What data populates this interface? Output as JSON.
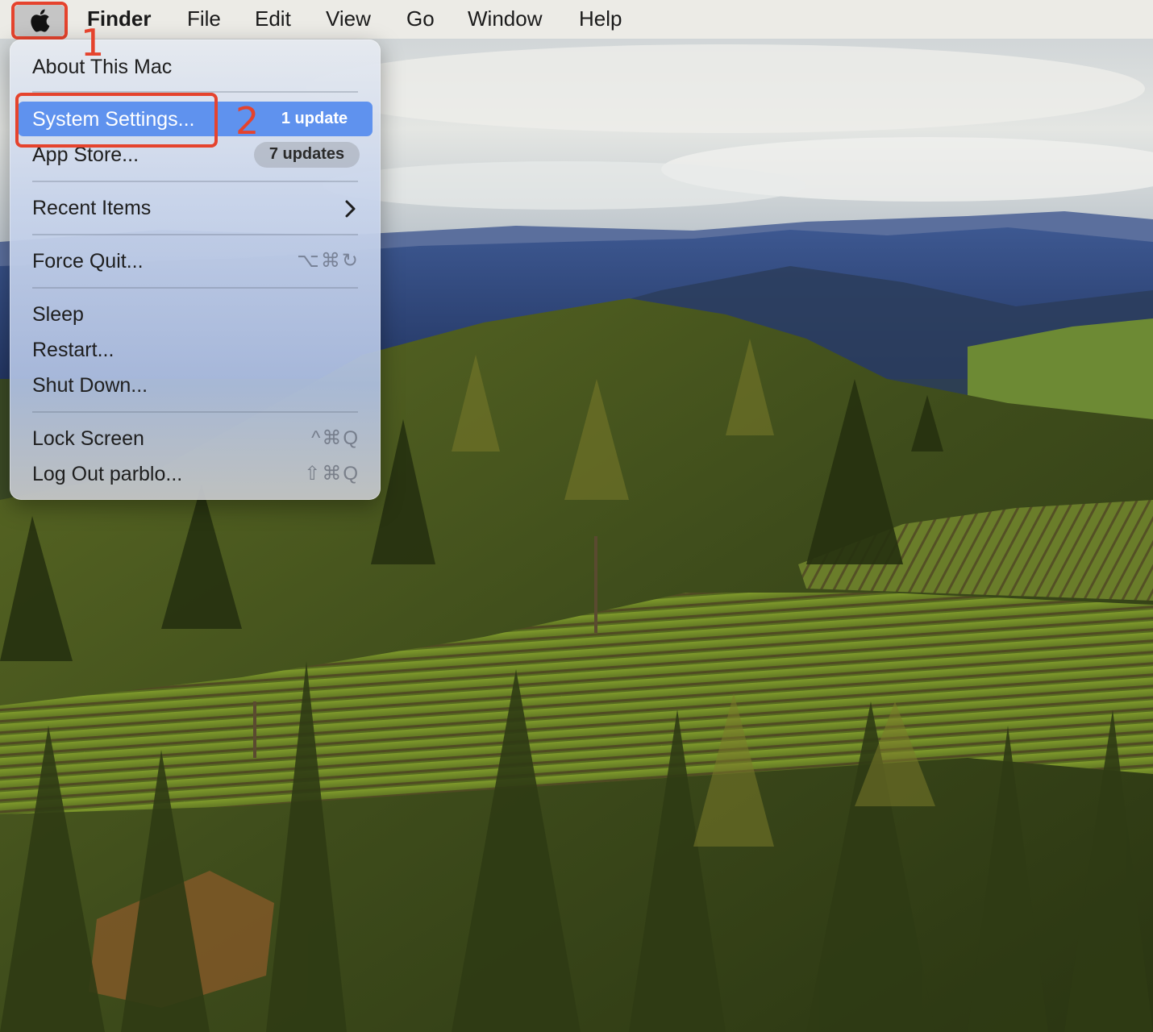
{
  "menubar": {
    "apple_icon": "apple-logo-icon",
    "items": [
      {
        "label": "Finder"
      },
      {
        "label": "File"
      },
      {
        "label": "Edit"
      },
      {
        "label": "View"
      },
      {
        "label": "Go"
      },
      {
        "label": "Window"
      },
      {
        "label": "Help"
      }
    ]
  },
  "annotations": {
    "step1": "1",
    "step2": "2",
    "color": "#e5432d"
  },
  "apple_menu": {
    "about": "About This Mac",
    "system_settings": "System Settings...",
    "system_settings_badge": "1 update",
    "app_store": "App Store...",
    "app_store_badge": "7 updates",
    "recent_items": "Recent Items",
    "recent_items_icon": "chevron-right-icon",
    "force_quit": "Force Quit...",
    "force_quit_shortcut": "⌥⌘↻",
    "sleep": "Sleep",
    "restart": "Restart...",
    "shut_down": "Shut Down...",
    "lock_screen": "Lock Screen",
    "lock_screen_shortcut": "^⌘Q",
    "log_out": "Log Out parblo...",
    "log_out_shortcut": "⇧⌘Q",
    "highlight_color": "#5f92ee"
  }
}
